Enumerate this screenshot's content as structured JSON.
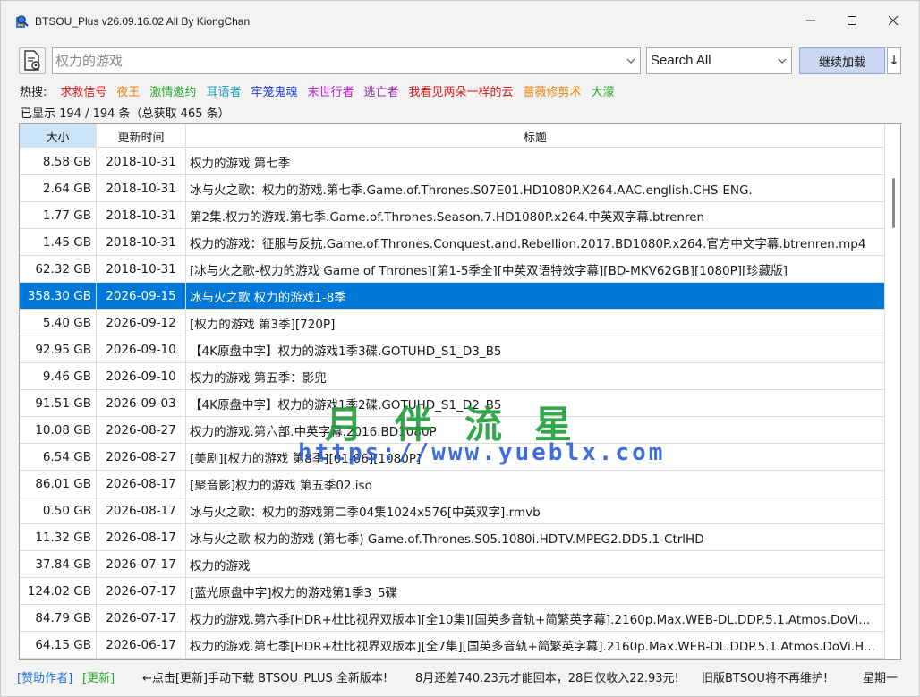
{
  "window": {
    "title": "BTSOU_Plus v26.09.16.02 All By KiongChan",
    "minimize_glyph": "—",
    "maximize_glyph": "☐",
    "close_glyph": "✕"
  },
  "search": {
    "value": "",
    "placeholder": "权力的游戏",
    "scope": "Search All",
    "load_more_label": "继续加载",
    "sort_glyph": "↓"
  },
  "hot": {
    "label": "热搜:",
    "items": [
      {
        "text": "求救信号",
        "color": "#e02020"
      },
      {
        "text": "夜王",
        "color": "#e8820c"
      },
      {
        "text": "激情邀约",
        "color": "#2aa52a"
      },
      {
        "text": "耳语者",
        "color": "#1a9fb5"
      },
      {
        "text": "牢笼鬼魂",
        "color": "#1f3bd6"
      },
      {
        "text": "末世行者",
        "color": "#c21ad6"
      },
      {
        "text": "逃亡者",
        "color": "#8f2aa8"
      },
      {
        "text": "我看见两朵一样的云",
        "color": "#d41c1c"
      },
      {
        "text": "蔷薇修剪术",
        "color": "#e8820c"
      },
      {
        "text": "大濛",
        "color": "#2aa52a"
      }
    ]
  },
  "stats": "已显示 194 / 194 条（总获取 465 条）",
  "table": {
    "headers": {
      "size": "大小",
      "date": "更新时间",
      "title": "标题"
    },
    "rows": [
      {
        "size": "8.58 GB",
        "date": "2018-10-31",
        "title": "权力的游戏 第七季"
      },
      {
        "size": "2.64 GB",
        "date": "2018-10-31",
        "title": "冰与火之歌：权力的游戏.第七季.Game.of.Thrones.S07E01.HD1080P.X264.AAC.english.CHS-ENG."
      },
      {
        "size": "1.77 GB",
        "date": "2018-10-31",
        "title": "第2集.权力的游戏.第七季.Game.of.Thrones.Season.7.HD1080P.x264.中英双字幕.btrenren"
      },
      {
        "size": "1.45 GB",
        "date": "2018-10-31",
        "title": "权力的游戏：征服与反抗.Game.of.Thrones.Conquest.and.Rebellion.2017.BD1080P.x264.官方中文字幕.btrenren.mp4"
      },
      {
        "size": "62.32 GB",
        "date": "2018-10-31",
        "title": "[冰与火之歌-权力的游戏 Game of Thrones][第1-5季全][中英双语特效字幕][BD-MKV62GB][1080P][珍藏版]"
      },
      {
        "size": "358.30 GB",
        "date": "2026-09-15",
        "title": "冰与火之歌 权力的游戏1-8季",
        "selected": true
      },
      {
        "size": "5.40 GB",
        "date": "2026-09-12",
        "title": "[权力的游戏 第3季][720P]"
      },
      {
        "size": "92.95 GB",
        "date": "2026-09-10",
        "title": "【4K原盘中字】权力的游戏1季3碟.GOTUHD_S1_D3_B5"
      },
      {
        "size": "9.46 GB",
        "date": "2026-09-10",
        "title": "权力的游戏 第五季：影兜"
      },
      {
        "size": "91.51 GB",
        "date": "2026-09-03",
        "title": "【4K原盘中字】权力的游戏1季2碟.GOTUHD_S1_D2_B5"
      },
      {
        "size": "10.08 GB",
        "date": "2026-08-27",
        "title": "权力的游戏.第六部.中英字幕.2016.BD1080P"
      },
      {
        "size": "6.54 GB",
        "date": "2026-08-27",
        "title": "[美剧][权力的游戏 第8季][01-06][1080P]"
      },
      {
        "size": "86.01 GB",
        "date": "2026-08-17",
        "title": "[聚音影]权力的游戏 第五季02.iso"
      },
      {
        "size": "0.50 GB",
        "date": "2026-08-17",
        "title": "冰与火之歌：权力的游戏第二季04集1024x576[中英双字].rmvb"
      },
      {
        "size": "11.32 GB",
        "date": "2026-08-17",
        "title": "冰与火之歌 权力的游戏 (第七季) Game.of.Thrones.S05.1080i.HDTV.MPEG2.DD5.1-CtrlHD"
      },
      {
        "size": "37.84 GB",
        "date": "2026-07-17",
        "title": "权力的游戏"
      },
      {
        "size": "124.02 GB",
        "date": "2026-07-17",
        "title": "[蓝光原盘中字]权力的游戏第1季3_5碟"
      },
      {
        "size": "84.79 GB",
        "date": "2026-07-17",
        "title": "权力的游戏.第六季[HDR+杜比视界双版本][全10集][国英多音轨+简繁英字幕].2160p.Max.WEB-DL.DDP.5.1.Atmos.DoVi..."
      },
      {
        "size": "64.15 GB",
        "date": "2026-06-17",
        "title": "权力的游戏.第七季[HDR+杜比视界双版本][全7集][国英多音轨+简繁英字幕].2160p.Max.WEB-DL.DDP.5.1.Atmos.DoVi.H..."
      },
      {
        "size": "",
        "date": "",
        "title": ""
      }
    ]
  },
  "watermark": {
    "cn": "月伴流星",
    "url": "https://www.yueblx.com"
  },
  "status": {
    "sponsor": "[赞助作者]",
    "update": "[更新]",
    "notice1": "←点击[更新]手动下载 BTSOU_PLUS 全新版本!",
    "notice2": "8月还差740.23元才能回本，28日仅收入22.93元!",
    "notice3": "旧版BTSOU将不再维护!",
    "weekday": "星期一",
    "colors": {
      "sponsor": "#1f6fd6",
      "update": "#2aa52a"
    }
  }
}
